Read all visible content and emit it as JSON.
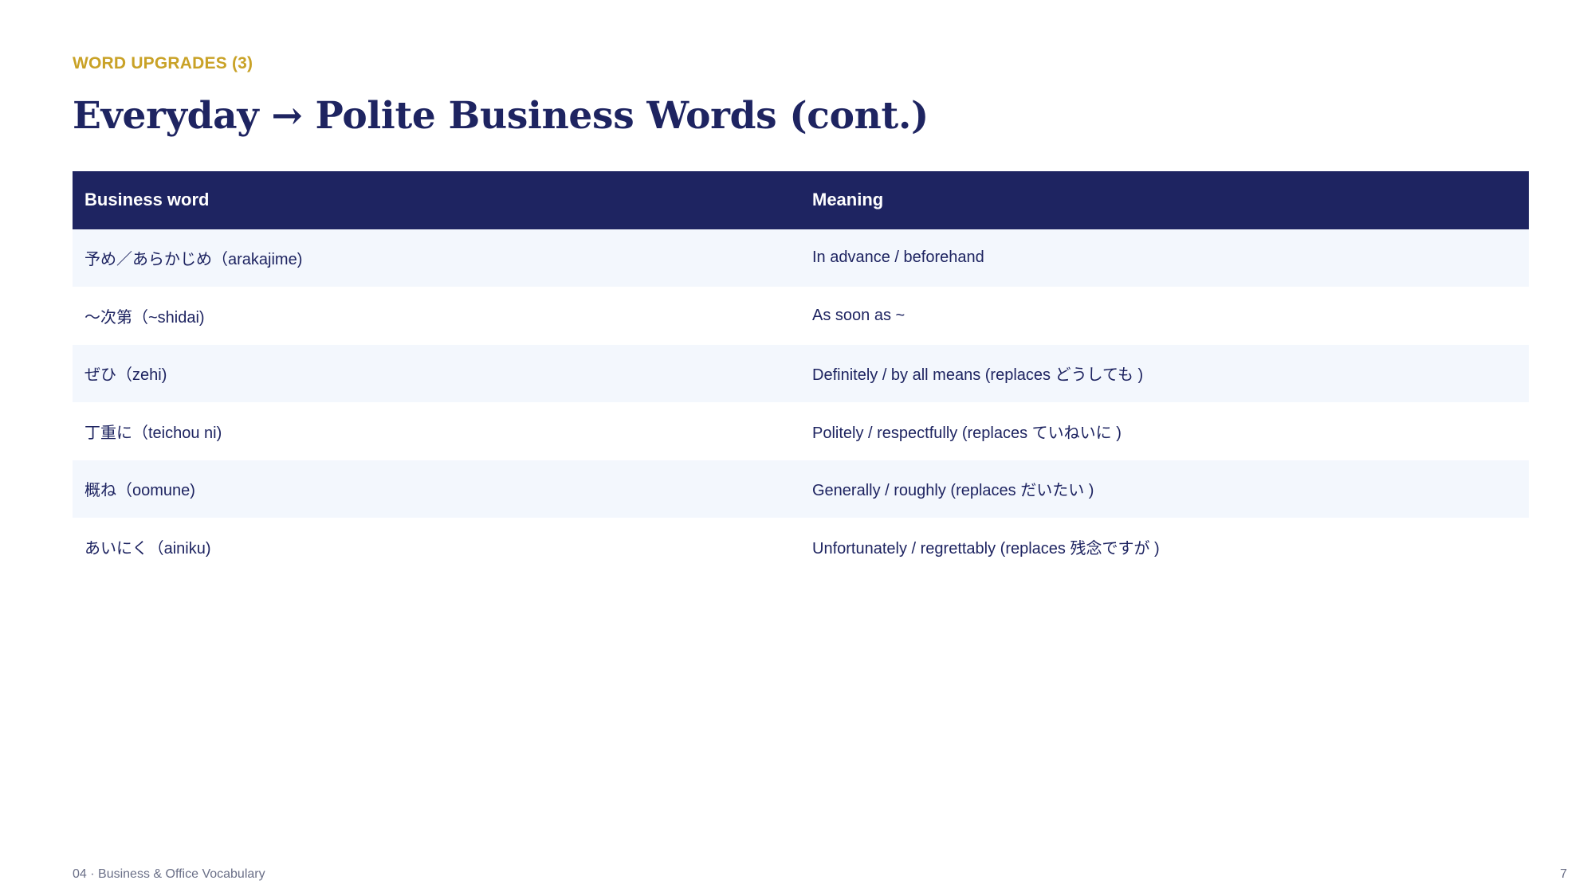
{
  "header": {
    "kicker": "WORD UPGRADES (3)",
    "title": "Everyday → Polite Business Words (cont.)"
  },
  "table": {
    "columns": [
      "Business word",
      "Meaning"
    ],
    "rows": [
      [
        "予め／あらかじめ（arakajime)",
        "In advance / beforehand"
      ],
      [
        "〜次第（~shidai)",
        "As soon as ~"
      ],
      [
        "ぜひ（zehi)",
        "Definitely / by all means (replaces どうしても )"
      ],
      [
        "丁重に（teichou ni)",
        "Politely / respectfully (replaces ていねいに )"
      ],
      [
        "概ね（oomune)",
        "Generally / roughly (replaces だいたい )"
      ],
      [
        "あいにく（ainiku)",
        "Unfortunately / regrettably (replaces 残念ですが )"
      ]
    ]
  },
  "footer": {
    "section": "04 · Business & Office Vocabulary",
    "page_number": "7"
  },
  "colors": {
    "navy": "#1e2461",
    "gold": "#c9a227",
    "stripe": "#f3f7fd"
  }
}
